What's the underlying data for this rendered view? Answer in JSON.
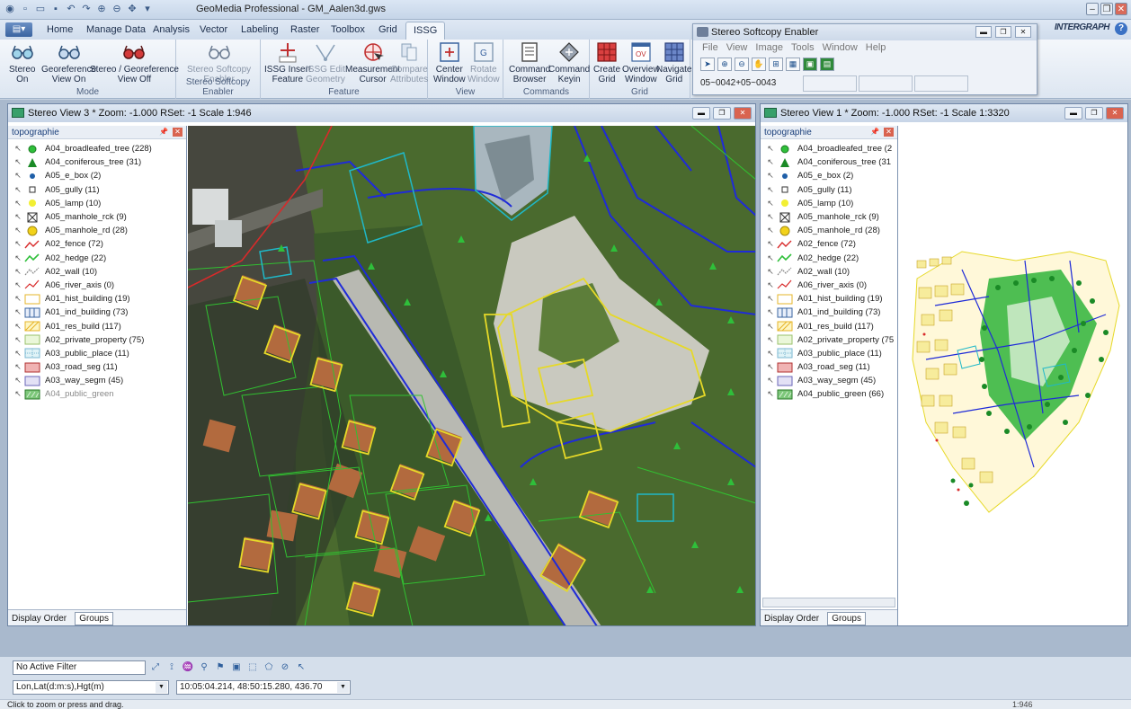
{
  "window": {
    "title": "GeoMedia Professional - GM_Aalen3d.gws",
    "brand": "INTERGRAPH"
  },
  "ribbon_tabs": [
    "Home",
    "Manage Data",
    "Analysis",
    "Vector",
    "Labeling",
    "Raster",
    "Toolbox",
    "Grid",
    "ISSG"
  ],
  "ribbon_active_tab": "ISSG",
  "ribbon": {
    "mode": {
      "name": "Mode",
      "buttons": [
        {
          "line1": "Stereo",
          "line2": "On"
        },
        {
          "line1": "Georeference",
          "line2": "View On"
        },
        {
          "line1": "Stereo / Georeference",
          "line2": "View Off"
        }
      ]
    },
    "sse": {
      "name": "Stereo Softcopy Enabler",
      "buttons": [
        {
          "line1": "Stereo Softcopy",
          "line2": "Enabler"
        }
      ]
    },
    "feature": {
      "name": "Feature",
      "buttons": [
        {
          "line1": "ISSG Insert",
          "line2": "Feature"
        },
        {
          "line1": "ISSG Edit",
          "line2": "Geometry"
        },
        {
          "line1": "Measurement",
          "line2": "Cursor"
        },
        {
          "line1": "Compare",
          "line2": "Attributes"
        }
      ]
    },
    "view": {
      "name": "View",
      "buttons": [
        {
          "line1": "Center",
          "line2": "Window"
        },
        {
          "line1": "Rotate",
          "line2": "Window"
        }
      ]
    },
    "commands": {
      "name": "Commands",
      "buttons": [
        {
          "line1": "Command",
          "line2": "Browser"
        },
        {
          "line1": "Command",
          "line2": "Keyin"
        }
      ]
    },
    "grid": {
      "name": "Grid",
      "buttons": [
        {
          "line1": "Create",
          "line2": "Grid"
        },
        {
          "line1": "Overview",
          "line2": "Window"
        },
        {
          "line1": "Navigate",
          "line2": "Grid"
        }
      ]
    }
  },
  "ssc_window": {
    "title": "Stereo Softcopy Enabler",
    "menu": [
      "File",
      "View",
      "Image",
      "Tools",
      "Window",
      "Help"
    ],
    "status": "05~0042+05~0043"
  },
  "stereo_view_3": {
    "title": "Stereo View 3 *  Zoom: -1.000  RSet: -1  Scale 1:946",
    "legend_title": "topographie",
    "tab_display_order": "Display Order",
    "tab_groups": "Groups",
    "items": [
      "A04_broadleafed_tree (228)",
      "A04_coniferous_tree (31)",
      "A05_e_box (2)",
      "A05_gully (11)",
      "A05_lamp (10)",
      "A05_manhole_rck (9)",
      "A05_manhole_rd (28)",
      "A02_fence (72)",
      "A02_hedge (22)",
      "A02_wall (10)",
      "A06_river_axis (0)",
      "A01_hist_building (19)",
      "A01_ind_building (73)",
      "A01_res_build (117)",
      "A02_private_property (75)",
      "A03_public_place (11)",
      "A03_road_seg (11)",
      "A03_way_segm (45)",
      "A04_public_green"
    ]
  },
  "stereo_view_1": {
    "title": "Stereo View 1 *  Zoom: -1.000  RSet: -1  Scale 1:3320",
    "legend_title": "topographie",
    "tab_display_order": "Display Order",
    "tab_groups": "Groups",
    "items": [
      "A04_broadleafed_tree (2",
      "A04_coniferous_tree (31",
      "A05_e_box (2)",
      "A05_gully (11)",
      "A05_lamp (10)",
      "A05_manhole_rck (9)",
      "A05_manhole_rd (28)",
      "A02_fence (72)",
      "A02_hedge (22)",
      "A02_wall (10)",
      "A06_river_axis (0)",
      "A01_hist_building (19)",
      "A01_ind_building (73)",
      "A01_res_build (117)",
      "A02_private_property (75",
      "A03_public_place (11)",
      "A03_road_seg (11)",
      "A03_way_segm (45)",
      "A04_public_green (66)"
    ]
  },
  "bottom": {
    "filter": "No Active Filter",
    "coord_system": "Lon,Lat(d:m:s),Hgt(m)",
    "coord_value": "10:05:04.214, 48:50:15.280, 436.70",
    "status_text": "Click to zoom or press and drag.",
    "scale": "1:946"
  },
  "colors": {
    "accent": "#3a64a0",
    "ribbon": "#dde6f1",
    "road": "#1f2bd8",
    "building": "#e6d928",
    "parcel": "#31c131",
    "public_place": "#1fb8c8",
    "fence": "#d82a2a"
  }
}
